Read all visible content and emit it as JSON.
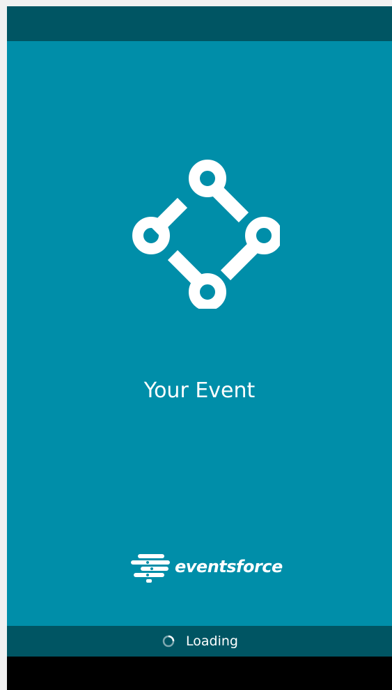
{
  "app": {
    "event_name": "Your Event",
    "brand_name": "eventsforce"
  },
  "loading": {
    "text": "Loading"
  },
  "icons": {
    "app_logo": "network-nodes-icon",
    "brand_logo": "eventsforce-logo-icon",
    "spinner": "loading-spinner-icon"
  },
  "colors": {
    "status_bar": "#005563",
    "background": "#008ea9",
    "loading_bar": "#005563",
    "nav_bar": "#000000",
    "foreground": "#ffffff"
  }
}
